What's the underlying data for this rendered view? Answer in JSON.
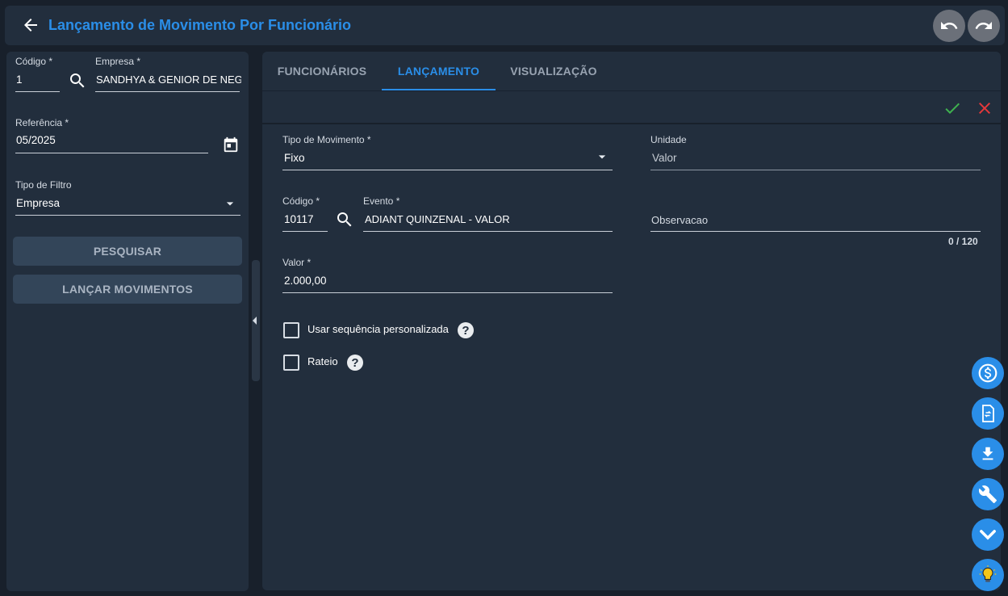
{
  "header": {
    "title": "Lançamento de Movimento Por Funcionário"
  },
  "filters": {
    "codigo": {
      "label": "Código *",
      "value": "1"
    },
    "empresa": {
      "label": "Empresa *",
      "value": "SANDHYA & GENIOR DE NEGO"
    },
    "referencia": {
      "label": "Referência *",
      "value": "05/2025"
    },
    "tipo_filtro": {
      "label": "Tipo de Filtro",
      "value": "Empresa"
    },
    "pesquisar_label": "PESQUISAR",
    "lancar_label": "LANÇAR MOVIMENTOS"
  },
  "tabs": [
    {
      "label": "FUNCIONÁRIOS"
    },
    {
      "label": "LANÇAMENTO"
    },
    {
      "label": "VISUALIZAÇÃO"
    }
  ],
  "active_tab": "LANÇAMENTO",
  "form": {
    "tipo_movimento": {
      "label": "Tipo de Movimento *",
      "value": "Fixo"
    },
    "unidade": {
      "label": "Unidade",
      "value": "Valor"
    },
    "codigo": {
      "label": "Código *",
      "value": "10117"
    },
    "evento": {
      "label": "Evento *",
      "value": "ADIANT QUINZENAL - VALOR"
    },
    "observacao": {
      "placeholder": "Observacao",
      "counter": "0 / 120"
    },
    "valor": {
      "label": "Valor *",
      "value": "2.000,00"
    },
    "usar_sequencia": {
      "label": "Usar sequência personalizada",
      "checked": false
    },
    "rateio": {
      "label": "Rateio",
      "checked": false
    }
  },
  "colors": {
    "accent": "#2a8ee8",
    "confirm": "#3fb24f",
    "cancel": "#e5383b",
    "panel": "#222e3d",
    "background": "#18202b"
  },
  "icons": [
    "back-arrow-icon",
    "undo-icon",
    "redo-icon",
    "search-icon",
    "calendar-icon",
    "dropdown-arrow-icon",
    "check-icon",
    "close-icon",
    "help-icon",
    "dollar-icon",
    "transfer-document-icon",
    "download-icon",
    "wrench-icon",
    "chevron-down-icon",
    "lightbulb-icon"
  ]
}
